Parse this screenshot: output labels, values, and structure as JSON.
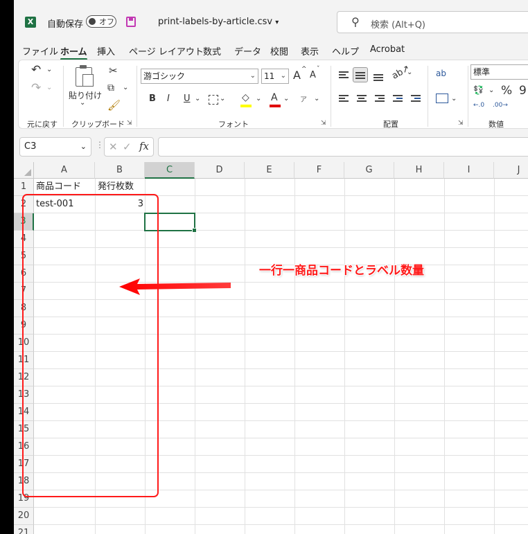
{
  "titlebar": {
    "app_icon_letter": "X",
    "autosave_label": "自動保存",
    "autosave_state": "オフ",
    "filename": "print-labels-by-article.csv",
    "filename_caret": "▾",
    "search_placeholder": "検索 (Alt+Q)"
  },
  "menu": {
    "items": [
      "ファイル",
      "ホーム",
      "挿入",
      "ページ レイアウト",
      "数式",
      "データ",
      "校閲",
      "表示",
      "ヘルプ",
      "Acrobat"
    ],
    "active": "ホーム"
  },
  "ribbon": {
    "undo_group_label": "元に戻す",
    "clipboard": {
      "paste_label": "貼り付け",
      "paste_caret": "⌄",
      "group_label": "クリップボード"
    },
    "font": {
      "name": "游ゴシック",
      "size": "11",
      "bold": "B",
      "italic": "I",
      "underline": "U",
      "grow": "A",
      "shrink": "A",
      "font_color_glyph": "A",
      "phonetic_glyph": "ア",
      "group_label": "フォント"
    },
    "alignment": {
      "group_label": "配置",
      "wrap_glyph": "ab"
    },
    "number": {
      "format": "標準",
      "percent": "%",
      "comma": "9",
      "group_label": "数値",
      "inc_dec": ".0",
      "dec_dec": ".00"
    }
  },
  "formula_bar": {
    "name_box": "C3",
    "fx": "fx",
    "content": ""
  },
  "sheet": {
    "columns": [
      "A",
      "B",
      "C",
      "D",
      "E",
      "F",
      "G",
      "H",
      "I",
      "J"
    ],
    "selected_column": "C",
    "rows": [
      "1",
      "2",
      "3",
      "4",
      "5",
      "6",
      "7",
      "8",
      "9",
      "10",
      "11",
      "12",
      "13",
      "14",
      "15",
      "16",
      "17",
      "18",
      "19",
      "20",
      "21"
    ],
    "selected_row": "3",
    "cells": {
      "A1": "商品コード",
      "B1": "発行枚数",
      "A2": "test-001",
      "B2": "3"
    },
    "active_cell": "C3"
  },
  "annotation": {
    "text": "一行一商品コードとラベル数量",
    "color": "#ff1a1a"
  },
  "colors": {
    "accent": "#1f7244",
    "save_icon": "#c239b3"
  }
}
